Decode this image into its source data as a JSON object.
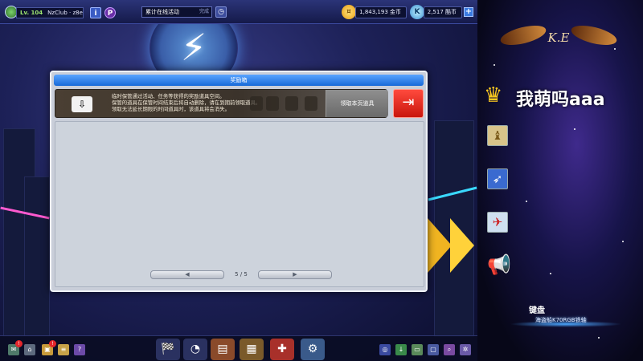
{
  "hud": {
    "level": "Lv. 104",
    "player_name": "NzClub · z8e",
    "info_btn": "i",
    "p_btn": "P",
    "event_title": "累计在线活动",
    "event_sub": "完成",
    "gold": "1,843,193 金币",
    "coupons": "2,517 酷币",
    "plus": "+"
  },
  "dialog": {
    "title": "奖励箱",
    "info_lines": [
      "临时保管通过活动、任务等获得的奖励道具空间。",
      "保管的道具在保管时间结束后将自动删除，请在到期前领取道具。",
      "领取无法延长期限的时间道具时，该道具将会消失。"
    ],
    "claim_button": "领取本页道具",
    "prev_label": "◀",
    "next_label": "▶",
    "page_current": "5",
    "page_sep": "/",
    "page_total": "5"
  },
  "bottom": {
    "badge_1": "!",
    "badge_2": "!",
    "help": "?"
  },
  "overlay": {
    "logo_text": "K.E",
    "streamer_name": "我萌吗aaa",
    "keyboard_label": "键盘",
    "keyboard_name": "海盗船K70RGB铁轴"
  },
  "colors": {
    "title_blue": "#1769d8",
    "exit_red": "#d91d12",
    "gold": "#ffb51f",
    "crown": "#ffcb1f"
  }
}
